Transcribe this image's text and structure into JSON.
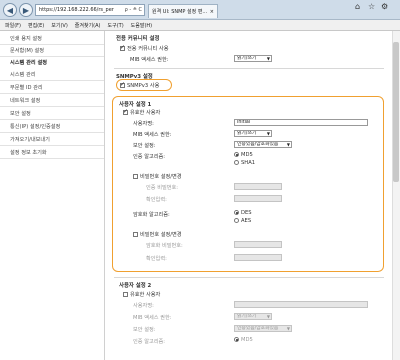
{
  "browser": {
    "address": "https://192.168.222.66/rs_per",
    "address_tail": "ρ - ≙ C",
    "tab_title": "원격 UI: SNMP 설정 편...",
    "win_controls": [
      "⌂",
      "☆",
      "⚙"
    ],
    "menu": [
      "파일(F)",
      "편집(E)",
      "보기(V)",
      "즐겨찾기(A)",
      "도구(T)",
      "도움말(H)"
    ]
  },
  "sidebar": {
    "items": [
      {
        "label": "인쇄 용지 설정",
        "head": false
      },
      {
        "label": "문서함(M) 설정",
        "head": false
      },
      {
        "label": "시스템 관리 설정",
        "head": true
      },
      {
        "label": "시스템 관리",
        "head": false
      },
      {
        "label": "부문별 ID 관리",
        "head": false
      },
      {
        "label": "네트워크 설정",
        "head": false
      },
      {
        "label": "보안 설정",
        "head": false
      },
      {
        "label": "통신(IP) 설정/인증설정",
        "head": false
      },
      {
        "label": "가져오기/내보내기",
        "head": false
      },
      {
        "label": "설정 정보 초기화",
        "head": false
      }
    ]
  },
  "content": {
    "comm_section": "전용 커뮤니티 설정",
    "use_private_community": "전용 커뮤니티 사용",
    "mib_access_label": "MIB 액세스 권한:",
    "mib_access_value": "읽기/쓰기",
    "snmpv3_section": "SNMPv3 설정",
    "use_snmpv3": "SNMPv3 사용",
    "user1": {
      "title": "사용자 설정 1",
      "enable": "유효한 사용자",
      "username_label": "사용자명:",
      "username_value": "initial",
      "mib_label": "MIB 액세스 권한:",
      "mib_value": "읽기/쓰기",
      "security_label": "보안 설정:",
      "security_value": "인증있음/암호화있음",
      "auth_algo_label": "인증 알고리즘:",
      "auth_opts": [
        "MD5",
        "SHA1"
      ],
      "auth_pw_change": "비밀번호 설정/변경",
      "auth_pw_label": "인증 비밀번호:",
      "confirm_label": "확인입력:",
      "enc_algo_label": "암호화 알고리즘:",
      "enc_opts": [
        "DES",
        "AES"
      ],
      "enc_pw_change": "비밀번호 설정/변경",
      "enc_pw_label": "암호화 비밀번호:",
      "enc_confirm_label": "확인입력:"
    },
    "user2": {
      "title": "사용자 설정 2",
      "enable": "유효한 사용자",
      "username_label": "사용자명:",
      "mib_label": "MIB 액세스 권한:",
      "mib_value": "읽기/쓰기",
      "security_label": "보안 설정:",
      "security_value": "인증있음/암호화있음",
      "auth_algo_label": "인증 알고리즘:",
      "auth_opts": [
        "MD5"
      ]
    }
  },
  "colors": {
    "highlight": "#f0a030",
    "titlebar": "#cfdce9"
  }
}
